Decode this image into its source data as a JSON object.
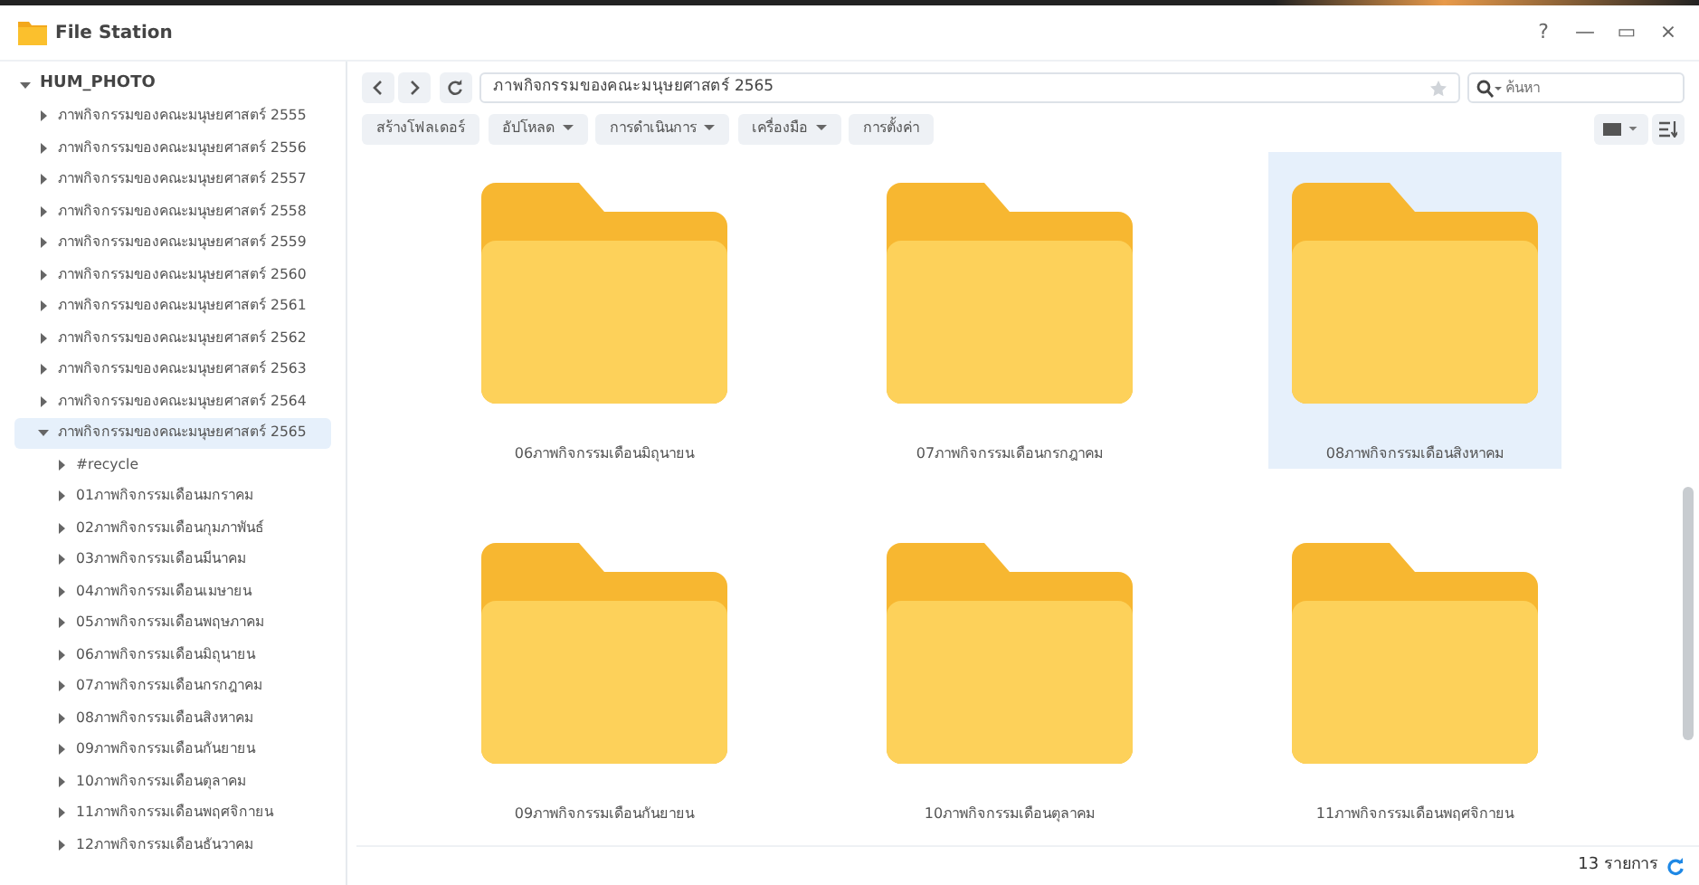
{
  "window": {
    "title": "File Station",
    "controls": [
      "?",
      "—",
      "▭",
      "×"
    ]
  },
  "tree": {
    "label": "HUM_PHOTO",
    "expanded": true,
    "children": [
      {
        "label": "ภาพกิจกรรมของคณะมนุษยศาสตร์ 2555",
        "expanded": false,
        "selected": false
      },
      {
        "label": "ภาพกิจกรรมของคณะมนุษยศาสตร์ 2556",
        "expanded": false,
        "selected": false
      },
      {
        "label": "ภาพกิจกรรมของคณะมนุษยศาสตร์ 2557",
        "expanded": false,
        "selected": false
      },
      {
        "label": "ภาพกิจกรรมของคณะมนุษยศาสตร์ 2558",
        "expanded": false,
        "selected": false
      },
      {
        "label": "ภาพกิจกรรมของคณะมนุษยศาสตร์ 2559",
        "expanded": false,
        "selected": false
      },
      {
        "label": "ภาพกิจกรรมของคณะมนุษยศาสตร์ 2560",
        "expanded": false,
        "selected": false
      },
      {
        "label": "ภาพกิจกรรมของคณะมนุษยศาสตร์ 2561",
        "expanded": false,
        "selected": false
      },
      {
        "label": "ภาพกิจกรรมของคณะมนุษยศาสตร์ 2562",
        "expanded": false,
        "selected": false
      },
      {
        "label": "ภาพกิจกรรมของคณะมนุษยศาสตร์ 2563",
        "expanded": false,
        "selected": false
      },
      {
        "label": "ภาพกิจกรรมของคณะมนุษยศาสตร์ 2564",
        "expanded": false,
        "selected": false
      },
      {
        "label": "ภาพกิจกรรมของคณะมนุษยศาสตร์ 2565",
        "expanded": true,
        "selected": true,
        "children": [
          {
            "label": "#recycle",
            "expanded": false,
            "selected": false
          },
          {
            "label": "01ภาพกิจกรรมเดือนมกราคม",
            "expanded": false,
            "selected": false
          },
          {
            "label": "02ภาพกิจกรรมเดือนกุมภาพันธ์",
            "expanded": false,
            "selected": false
          },
          {
            "label": "03ภาพกิจกรรมเดือนมีนาคม",
            "expanded": false,
            "selected": false
          },
          {
            "label": "04ภาพกิจกรรมเดือนเมษายน",
            "expanded": false,
            "selected": false
          },
          {
            "label": "05ภาพกิจกรรมเดือนพฤษภาคม",
            "expanded": false,
            "selected": false
          },
          {
            "label": "06ภาพกิจกรรมเดือนมิถุนายน",
            "expanded": false,
            "selected": false
          },
          {
            "label": "07ภาพกิจกรรมเดือนกรกฎาคม",
            "expanded": false,
            "selected": false
          },
          {
            "label": "08ภาพกิจกรรมเดือนสิงหาคม",
            "expanded": false,
            "selected": false
          },
          {
            "label": "09ภาพกิจกรรมเดือนกันยายน",
            "expanded": false,
            "selected": false
          },
          {
            "label": "10ภาพกิจกรรมเดือนตุลาคม",
            "expanded": false,
            "selected": false
          },
          {
            "label": "11ภาพกิจกรรมเดือนพฤศจิกายน",
            "expanded": false,
            "selected": false
          },
          {
            "label": "12ภาพกิจกรรมเดือนธันวาคม",
            "expanded": false,
            "selected": false
          }
        ]
      }
    ]
  },
  "path": {
    "value": "ภาพกิจกรรมของคณะมนุษยศาสตร์ 2565",
    "favorite": false
  },
  "search": {
    "placeholder": "ค้นหา"
  },
  "toolbar": [
    {
      "label": "สร้างโฟลเดอร์",
      "dropdown": false
    },
    {
      "label": "อัปโหลด",
      "dropdown": true
    },
    {
      "label": "การดำเนินการ",
      "dropdown": true
    },
    {
      "label": "เครื่องมือ",
      "dropdown": true
    },
    {
      "label": "การตั้งค่า",
      "dropdown": false
    }
  ],
  "folders": [
    {
      "name": "06ภาพกิจกรรมเดือนมิถุนายน",
      "selected": false
    },
    {
      "name": "07ภาพกิจกรรมเดือนกรกฎาคม",
      "selected": false
    },
    {
      "name": "08ภาพกิจกรรมเดือนสิงหาคม",
      "selected": true
    },
    {
      "name": "09ภาพกิจกรรมเดือนกันยายน",
      "selected": false
    },
    {
      "name": "10ภาพกิจกรรมเดือนตุลาคม",
      "selected": false
    },
    {
      "name": "11ภาพกิจกรรมเดือนพฤศจิกายน",
      "selected": false
    }
  ],
  "status_bar": {
    "count": "13 รายการ"
  }
}
